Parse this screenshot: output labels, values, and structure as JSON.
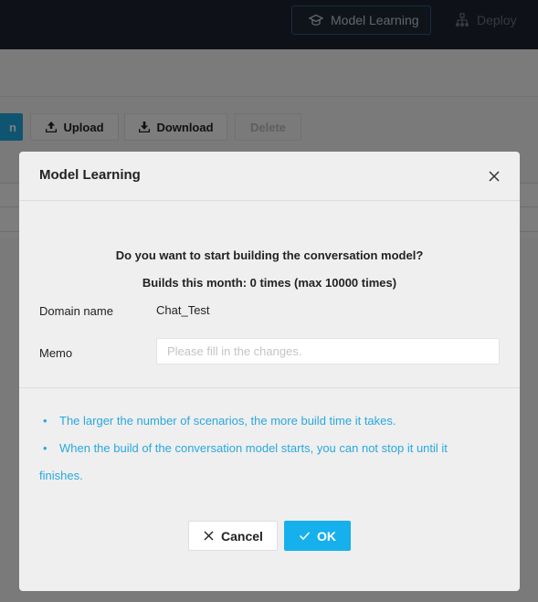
{
  "topnav": {
    "items": [
      {
        "label": "Model Learning",
        "icon": "graduation-cap-icon",
        "active": true
      },
      {
        "label": "Deploy",
        "icon": "sitemap-icon",
        "active": false
      }
    ]
  },
  "toolbar": {
    "partial_primary_label": "n",
    "upload_label": "Upload",
    "download_label": "Download",
    "delete_label": "Delete"
  },
  "modal": {
    "title": "Model Learning",
    "question": "Do you want to start building the conversation model?",
    "builds_info": "Builds this month: 0 times (max 10000 times)",
    "domain_label": "Domain name",
    "domain_value": "Chat_Test",
    "memo_label": "Memo",
    "memo_value": "",
    "memo_placeholder": "Please fill in the changes.",
    "notes": [
      "The larger the number of scenarios, the more build time it takes.",
      "When the build of the conversation model starts, you can not stop it until it finishes."
    ],
    "bullet": "•",
    "cancel_label": "Cancel",
    "ok_label": "OK"
  },
  "colors": {
    "accent": "#16b1ec",
    "note_text": "#29a8df",
    "topbar": "#1d2430"
  }
}
